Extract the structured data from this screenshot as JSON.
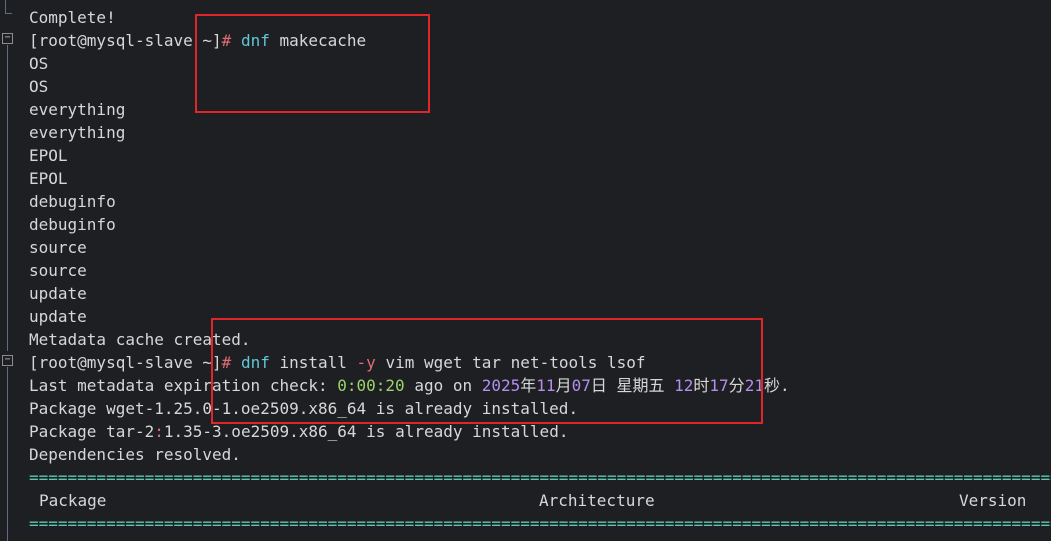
{
  "terminal": {
    "lines": {
      "complete": "Complete!",
      "prompt1": "[root@mysql-slave ~]",
      "hash": "#",
      "cmd1": "dnf",
      "cmd1_args": " makecache",
      "repo_os_1": "OS",
      "repo_os_2": "OS",
      "repo_everything_1": "everything",
      "repo_everything_2": "everything",
      "repo_epol_1": "EPOL",
      "repo_epol_2": "EPOL",
      "repo_debuginfo_1": "debuginfo",
      "repo_debuginfo_2": "debuginfo",
      "repo_source_1": "source",
      "repo_source_2": "source",
      "repo_update_1": "update",
      "repo_update_2": "update",
      "cache_created": "Metadata cache created.",
      "prompt2": "[root@mysql-slave ~]",
      "cmd2": "dnf",
      "cmd2_install": " install ",
      "cmd2_flag": "-y",
      "cmd2_pkgs": " vim wget tar net-tools lsof",
      "expire_prefix": "Last metadata expiration check: ",
      "expire_time": "0:00:20",
      "expire_mid": " ago on ",
      "date_year": "2025",
      "date_year_char": "年",
      "date_month": "11",
      "date_month_char": "月",
      "date_day": "07",
      "date_day_char": "日 星期五 ",
      "date_hour": "12",
      "date_hour_char": "时",
      "date_min": "17",
      "date_min_char": "分",
      "date_sec": "21",
      "date_sec_char": "秒.",
      "wget_installed": "Package wget-1.25.0-1.oe2509.x86_64 is already installed.",
      "tar_prefix": "Package tar-2",
      "tar_colon": ":",
      "tar_suffix": "1.35-3.oe2509.x86_64 is already installed.",
      "deps_resolved": "Dependencies resolved.",
      "rule": "=====================================================================================================================================================================",
      "col_package": "Package",
      "col_architecture": "Architecture",
      "col_version": "Version"
    }
  },
  "colors": {
    "background": "#1e1f22",
    "text": "#d7d7d7",
    "command": "#61c6d8",
    "hash_and_flag": "#e06c75",
    "time_value": "#9bd36a",
    "date_numbers": "#b48ef0",
    "rule": "#5fc7b1",
    "annotation_box": "#e0262b"
  }
}
